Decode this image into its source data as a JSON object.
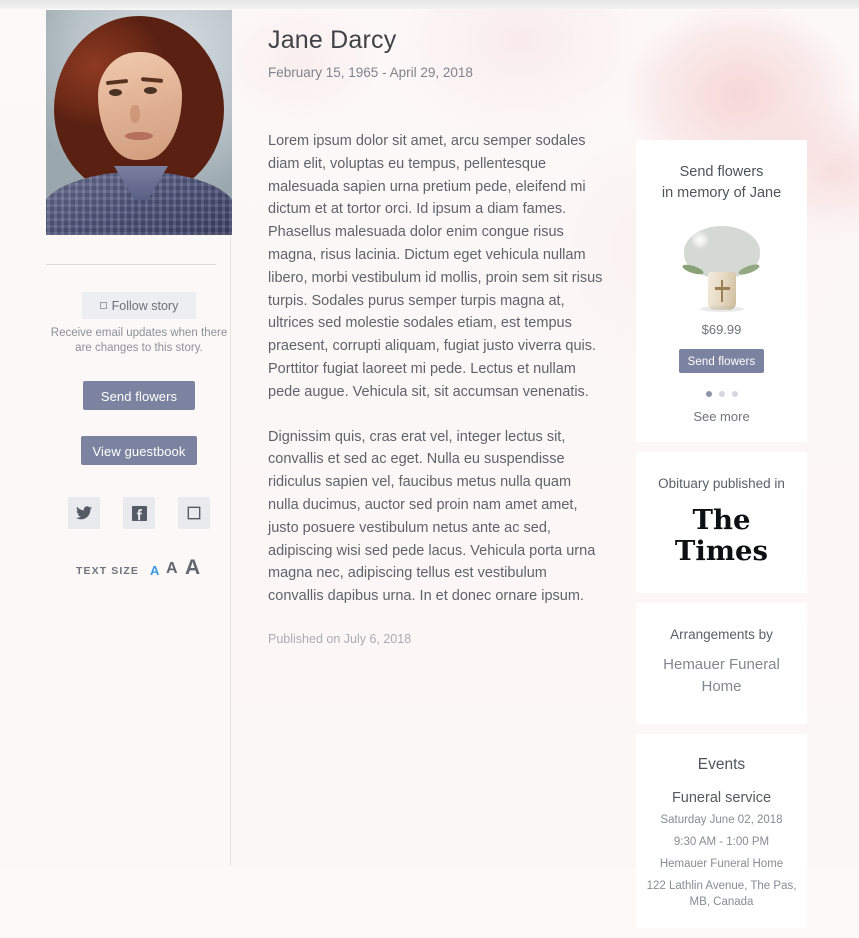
{
  "person": {
    "name": "Jane Darcy",
    "dates": "February 15, 1965 - April 29, 2018",
    "photo_alt": "portrait-of-jane-darcy"
  },
  "obituary": {
    "paragraph_1": "Lorem ipsum dolor sit amet, arcu semper sodales diam elit, voluptas eu tempus, pellentesque malesuada sapien urna pretium pede, eleifend mi dictum et at tortor orci. Id ipsum a diam fames. Phasellus malesuada dolor enim congue risus magna, risus lacinia. Dictum eget vehicula nullam libero, morbi vestibulum id mollis, proin sem sit risus turpis. Sodales purus semper turpis magna at, ultrices sed molestie sodales etiam, est tempus praesent, corrupti aliquam, fugiat justo viverra quis. Porttitor fugiat laoreet mi pede. Lectus et nullam pede augue. Vehicula sit, sit accumsan venenatis.",
    "paragraph_2": "Dignissim quis, cras erat vel, integer lectus sit, convallis et sed ac eget. Nulla eu suspendisse ridiculus sapien vel, faucibus metus nulla quam nulla ducimus, auctor sed proin nam amet amet, justo posuere vestibulum netus ante ac sed, adipiscing wisi sed pede lacus. Vehicula porta urna magna nec, adipiscing tellus est vestibulum convallis dapibus urna. In et donec ornare ipsum.",
    "published": "Published on July 6, 2018"
  },
  "sidebar": {
    "follow_label": "Follow story",
    "follow_note": "Receive email updates when there are changes to this story.",
    "send_flowers_label": "Send flowers",
    "view_guestbook_label": "View guestbook",
    "social": [
      {
        "name": "twitter-icon",
        "label": "Twitter"
      },
      {
        "name": "facebook-icon",
        "label": "Facebook"
      },
      {
        "name": "email-icon",
        "label": "Email"
      }
    ],
    "text_size": {
      "label": "TEXT SIZE",
      "small": "A",
      "medium": "A",
      "large": "A",
      "active": "small",
      "active_color": "#3d9ae0"
    }
  },
  "rail": {
    "flowers": {
      "title_line_1": "Send flowers",
      "title_line_2": "in memory of Jane",
      "product_image": "white-bouquet-with-cross",
      "price": "$69.99",
      "button_label": "Send flowers",
      "carousel_dots": 3,
      "carousel_active_index": 0,
      "see_more_label": "See more"
    },
    "publication": {
      "label": "Obituary published in",
      "name": "The Times"
    },
    "arrangements": {
      "label": "Arrangements by",
      "name": "Hemauer Funeral Home"
    },
    "events": {
      "title": "Events",
      "items": [
        {
          "name": "Funeral service",
          "date": "Saturday June 02, 2018",
          "time": "9:30 AM - 1:00 PM",
          "venue": "Hemauer Funeral Home",
          "address": "122 Lathlin Avenue, The Pas, MB, Canada"
        }
      ]
    }
  },
  "colors": {
    "primary_button": "#7b83a0",
    "page_background": "#fdf8f8",
    "card_background": "#ffffff",
    "accent_link": "#3d9ae0"
  }
}
